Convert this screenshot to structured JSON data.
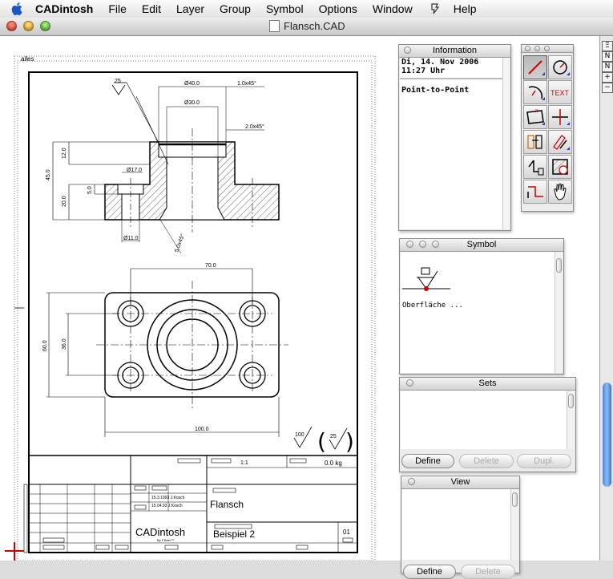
{
  "menu": {
    "app": "CADintosh",
    "items": [
      "File",
      "Edit",
      "Layer",
      "Group",
      "Symbol",
      "Options",
      "Window",
      "Help"
    ]
  },
  "window": {
    "title": "Flansch.CAD"
  },
  "canvas": {
    "layer_label": "alles",
    "drawing_labels": {
      "roughness_top": "25",
      "dia40": "Ø40.0",
      "chamfer1": "1.0x45°",
      "dia30": "Ø30.0",
      "chamfer2": "2.0x45°",
      "h12": "12.0",
      "dia17": "Ø17.0",
      "h45": "45.0",
      "h5": "5.0",
      "h20": "20.0",
      "dia11": "Ø11.0",
      "chamfer3": "5.0x45°",
      "w70": "70.0",
      "h60": "60.0",
      "h36": "36.0",
      "w100": "100.0",
      "rough100": "100",
      "rough25": "25"
    },
    "titleblock": {
      "scale": "1:1",
      "weight": "0.0 kg",
      "rev1": "15.3.1993 J.Kosch",
      "rev2": "15.04.93 J.Kosch",
      "name": "Flansch",
      "logo": "CADintosh",
      "logo_sub": "By F.Baer™",
      "drawing_no": "Beispiel 2",
      "sheet": "01"
    }
  },
  "side_buttons": [
    "Ξ",
    "N",
    "N",
    "+",
    "−"
  ],
  "info_panel": {
    "title": "Information",
    "date": "Di, 14. Nov 2006",
    "time": "11:27 Uhr",
    "mode": "Point-to-Point"
  },
  "symbol_panel": {
    "title": "Symbol",
    "symbol_name": "Oberfläche ..."
  },
  "sets_panel": {
    "title": "Sets",
    "buttons": [
      "Define",
      "Delete",
      "Dupl."
    ]
  },
  "view_panel": {
    "title": "View",
    "buttons": [
      "Define",
      "Delete"
    ]
  },
  "tools": {
    "text_label": "TEXT",
    "items": [
      "line-tool",
      "circle-tool",
      "arc-tool",
      "text-tool",
      "rectangle-tool",
      "crosshair-tool",
      "move-tool",
      "edit-tool",
      "trim-tool",
      "hatch-tool",
      "polyline-tool",
      "hand-tool"
    ]
  },
  "colors": {
    "accent": "#3a74c8",
    "cursor": "#cc0000",
    "text_tool": "#cc0000"
  }
}
